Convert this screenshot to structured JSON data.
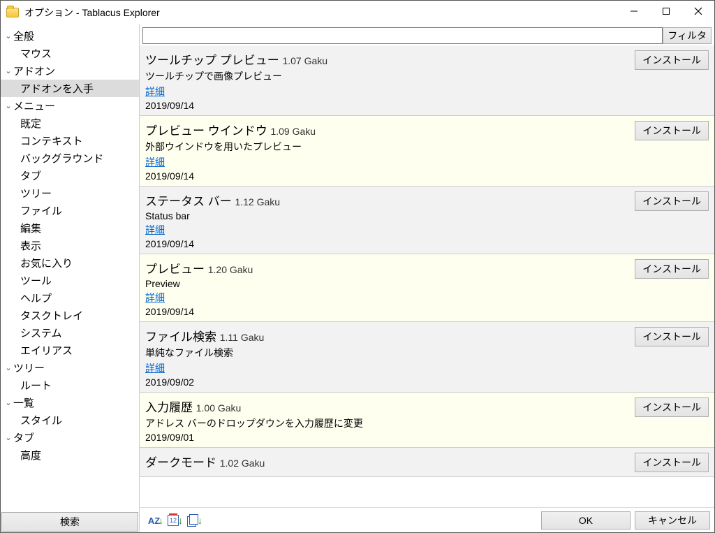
{
  "window": {
    "title": "オプション - Tablacus Explorer"
  },
  "sidebar": {
    "search_label": "検索",
    "tree": [
      {
        "label": "全般",
        "level": 0,
        "expandable": true,
        "expanded": true
      },
      {
        "label": "マウス",
        "level": 1
      },
      {
        "label": "アドオン",
        "level": 0,
        "expandable": true,
        "expanded": true
      },
      {
        "label": "アドオンを入手",
        "level": 1,
        "selected": true
      },
      {
        "label": "メニュー",
        "level": 0,
        "expandable": true,
        "expanded": true
      },
      {
        "label": "既定",
        "level": 1
      },
      {
        "label": "コンテキスト",
        "level": 1
      },
      {
        "label": "バックグラウンド",
        "level": 1
      },
      {
        "label": "タブ",
        "level": 1
      },
      {
        "label": "ツリー",
        "level": 1
      },
      {
        "label": "ファイル",
        "level": 1
      },
      {
        "label": "編集",
        "level": 1
      },
      {
        "label": "表示",
        "level": 1
      },
      {
        "label": "お気に入り",
        "level": 1
      },
      {
        "label": "ツール",
        "level": 1
      },
      {
        "label": "ヘルプ",
        "level": 1
      },
      {
        "label": "タスクトレイ",
        "level": 1
      },
      {
        "label": "システム",
        "level": 1
      },
      {
        "label": "エイリアス",
        "level": 1
      },
      {
        "label": "ツリー",
        "level": 0,
        "expandable": true,
        "expanded": true
      },
      {
        "label": "ルート",
        "level": 1
      },
      {
        "label": "一覧",
        "level": 0,
        "expandable": true,
        "expanded": true
      },
      {
        "label": "スタイル",
        "level": 1
      },
      {
        "label": "タブ",
        "level": 0,
        "expandable": true,
        "expanded": true
      },
      {
        "label": "高度",
        "level": 1
      }
    ]
  },
  "filter": {
    "value": "",
    "button_label": "フィルタ"
  },
  "labels": {
    "install": "インストール",
    "details": "詳細",
    "ok": "OK",
    "cancel": "キャンセル"
  },
  "addons": [
    {
      "name": "ツールチップ プレビュー",
      "version": "1.07",
      "author": "Gaku",
      "desc": "ツールチップで画像プレビュー",
      "has_details": true,
      "date": "2019/09/14",
      "alt": false
    },
    {
      "name": "プレビュー ウインドウ",
      "version": "1.09",
      "author": "Gaku",
      "desc": "外部ウインドウを用いたプレビュー",
      "has_details": true,
      "date": "2019/09/14",
      "alt": true
    },
    {
      "name": "ステータス バー",
      "version": "1.12",
      "author": "Gaku",
      "desc": "Status bar",
      "has_details": true,
      "date": "2019/09/14",
      "alt": false
    },
    {
      "name": "プレビュー",
      "version": "1.20",
      "author": "Gaku",
      "desc": "Preview",
      "has_details": true,
      "date": "2019/09/14",
      "alt": true
    },
    {
      "name": "ファイル検索",
      "version": "1.11",
      "author": "Gaku",
      "desc": "単純なファイル検索",
      "has_details": true,
      "date": "2019/09/02",
      "alt": false
    },
    {
      "name": "入力履歴",
      "version": "1.00",
      "author": "Gaku",
      "desc": "アドレス バーのドロップダウンを入力履歴に変更",
      "has_details": false,
      "date": "2019/09/01",
      "alt": true
    },
    {
      "name": "ダークモード",
      "version": "1.02",
      "author": "Gaku",
      "desc": "",
      "has_details": false,
      "date": "",
      "alt": false,
      "compact": true
    }
  ],
  "sort_icons": {
    "cal_num": "12"
  }
}
